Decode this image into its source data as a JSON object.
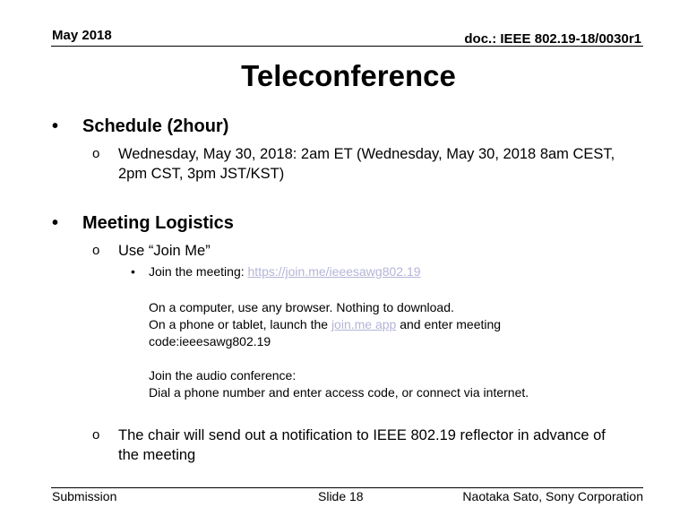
{
  "header": {
    "date": "May 2018",
    "doc_id": "doc.: IEEE 802.19-18/0030r1"
  },
  "title": "Teleconference",
  "sections": [
    {
      "bullet": "•",
      "heading": "Schedule (2hour)",
      "items": [
        {
          "bullet": "o",
          "text": "Wednesday, May 30, 2018: 2am ET (Wednesday, May 30, 2018 8am CEST, 2pm CST, 3pm JST/KST)"
        }
      ]
    },
    {
      "bullet": "•",
      "heading": "Meeting Logistics",
      "items": [
        {
          "bullet": "o",
          "text": "Use “Join Me”",
          "subitems": [
            {
              "bullet": "•",
              "label": "Join the meeting: ",
              "link_text": "https://join.me/ieeesawg802.19"
            }
          ]
        },
        {
          "bullet": "o",
          "text": "The chair will send out a notification to IEEE 802.19 reflector in advance of the meeting"
        }
      ]
    }
  ],
  "join_details": {
    "computer_line": "On a computer, use any browser. Nothing to download.",
    "phone_line_prefix": "On a phone or tablet, launch the ",
    "phone_link": "join.me app",
    "phone_line_suffix": " and enter meeting",
    "code_line": "code:ieeesawg802.19",
    "audio_heading": "Join the audio conference:",
    "audio_line": "Dial a phone number and enter access code, or connect via internet."
  },
  "footer": {
    "left": "Submission",
    "center": "Slide 18",
    "right": "Naotaka Sato, Sony Corporation"
  },
  "colors": {
    "link": "#b4b4d8",
    "text": "#000000",
    "background": "#ffffff"
  }
}
